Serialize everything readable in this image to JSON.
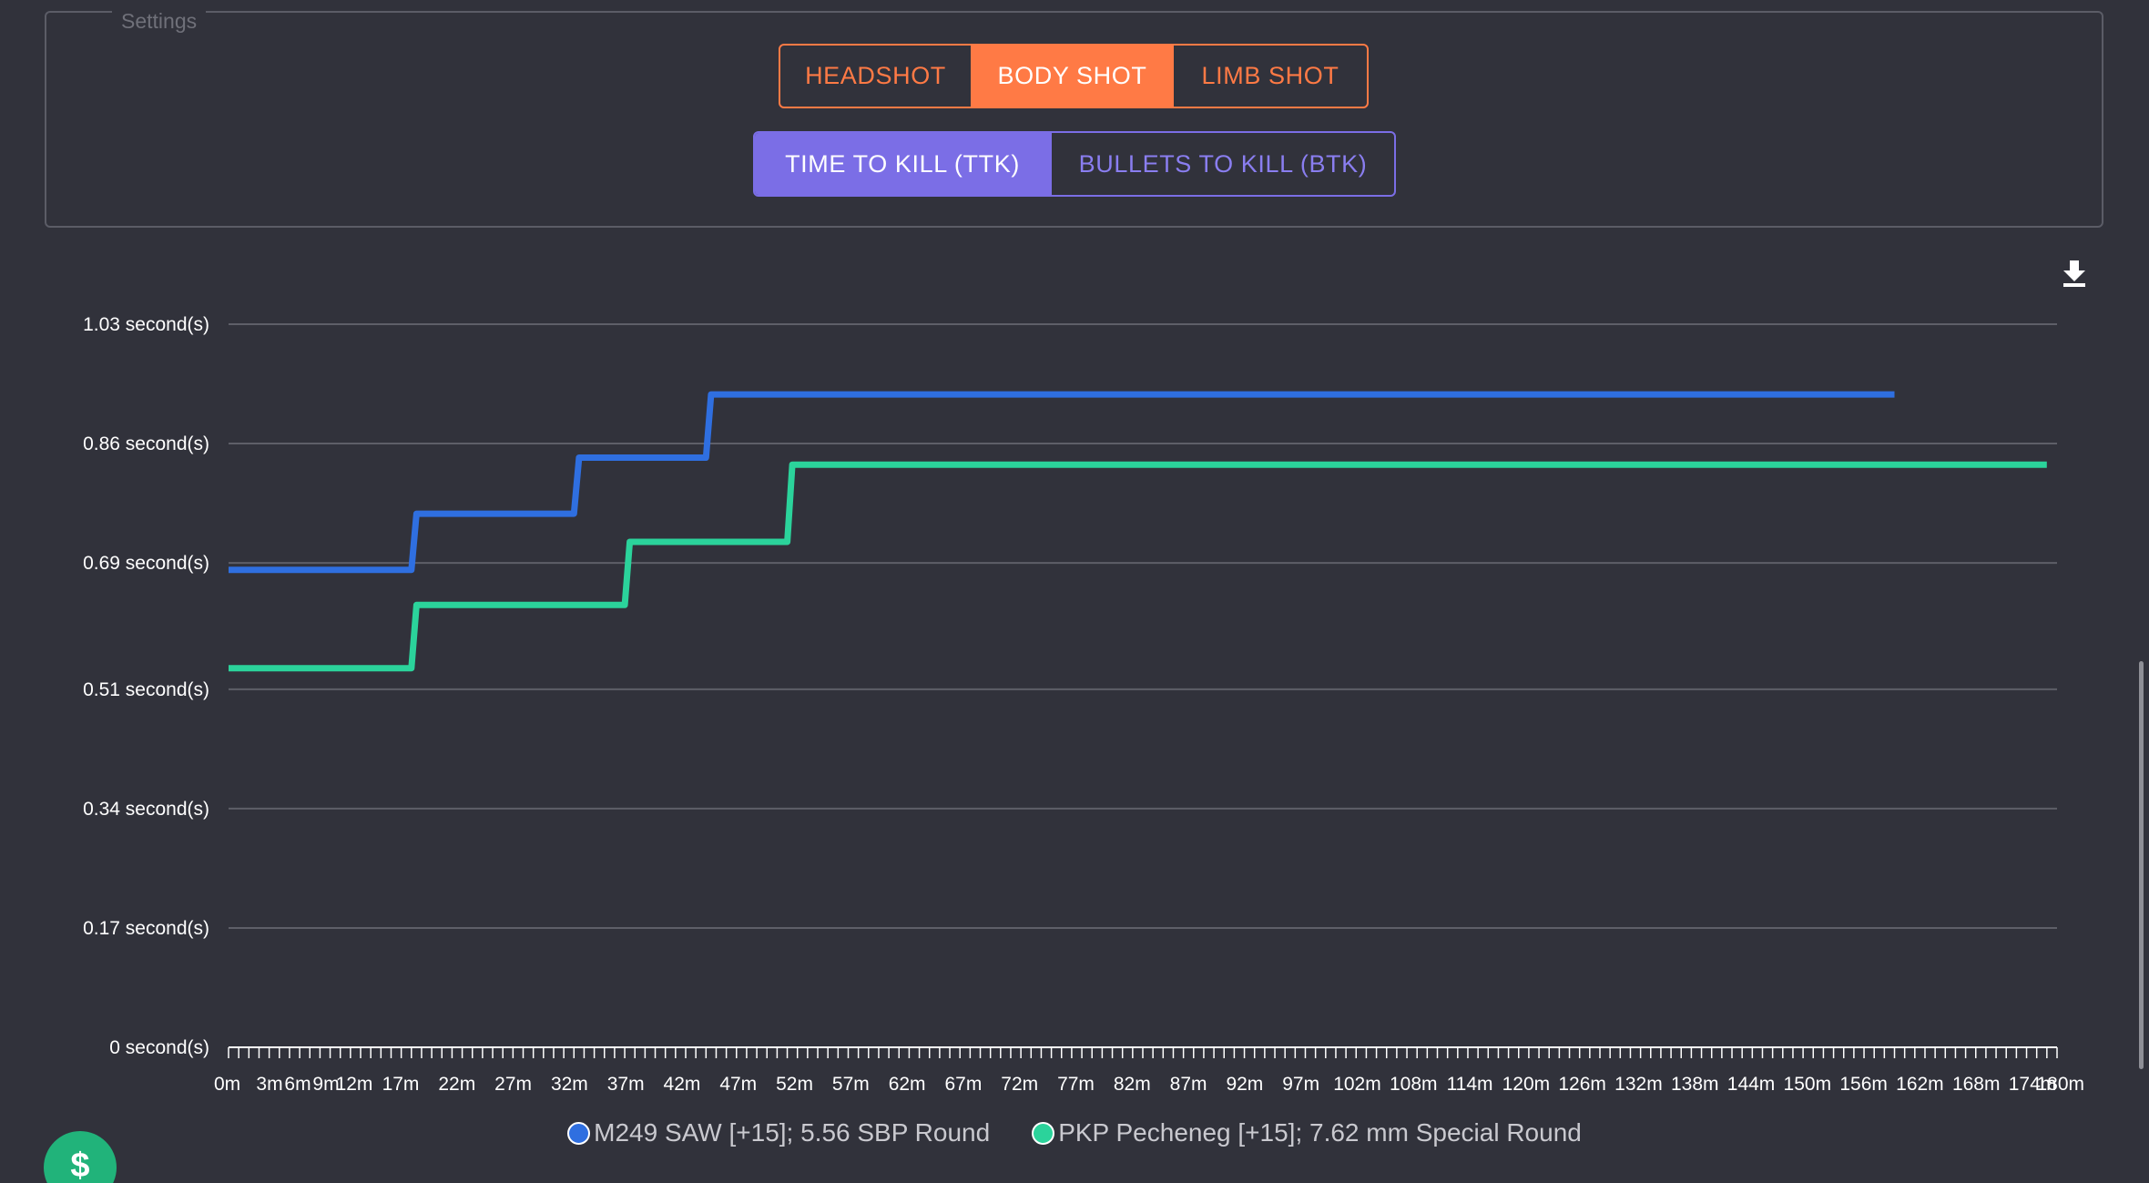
{
  "settings": {
    "legend": "Settings",
    "shot_types": [
      "HEADSHOT",
      "BODY SHOT",
      "LIMB SHOT"
    ],
    "shot_active": "BODY SHOT",
    "modes": [
      "TIME TO KILL (TTK)",
      "BULLETS TO KILL (BTK)"
    ],
    "mode_active": "TIME TO KILL (TTK)"
  },
  "toolbar": {
    "download_icon": "download-icon"
  },
  "fab": {
    "label": "$",
    "color": "#21b37a"
  },
  "chart_data": {
    "type": "line",
    "step": true,
    "x_unit": "m",
    "xlim": [
      0,
      180
    ],
    "ylim": [
      0,
      1.03
    ],
    "grid": true,
    "legend_position": "bottom",
    "y_ticks": [
      0,
      0.17,
      0.34,
      0.51,
      0.69,
      0.86,
      1.03
    ],
    "y_tick_labels": [
      "0 second(s)",
      "0.17 second(s)",
      "0.34 second(s)",
      "0.51 second(s)",
      "0.69 second(s)",
      "0.86 second(s)",
      "1.03 second(s)"
    ],
    "x_tick_labels": [
      "0m",
      "3m",
      "6m",
      "9m",
      "12m",
      "17m",
      "22m",
      "27m",
      "32m",
      "37m",
      "42m",
      "47m",
      "52m",
      "57m",
      "62m",
      "67m",
      "72m",
      "77m",
      "82m",
      "87m",
      "92m",
      "97m",
      "102m",
      "108m",
      "114m",
      "120m",
      "126m",
      "132m",
      "138m",
      "144m",
      "150m",
      "156m",
      "162m",
      "168m",
      "174m",
      "180m"
    ],
    "series": [
      {
        "name": "M249 SAW [+15]; 5.56 SBP Round",
        "color": "#2f6fe0",
        "x": [
          0,
          18,
          18.5,
          34,
          34.5,
          47,
          47.5,
          164
        ],
        "y": [
          0.68,
          0.68,
          0.76,
          0.76,
          0.84,
          0.84,
          0.93,
          0.93
        ]
      },
      {
        "name": "PKP Pecheneg [+15]; 7.62 mm Special Round",
        "color": "#2bd39b",
        "x": [
          0,
          18,
          18.5,
          39,
          39.5,
          55,
          55.5,
          179
        ],
        "y": [
          0.54,
          0.54,
          0.63,
          0.63,
          0.72,
          0.72,
          0.83,
          0.83
        ]
      }
    ]
  }
}
